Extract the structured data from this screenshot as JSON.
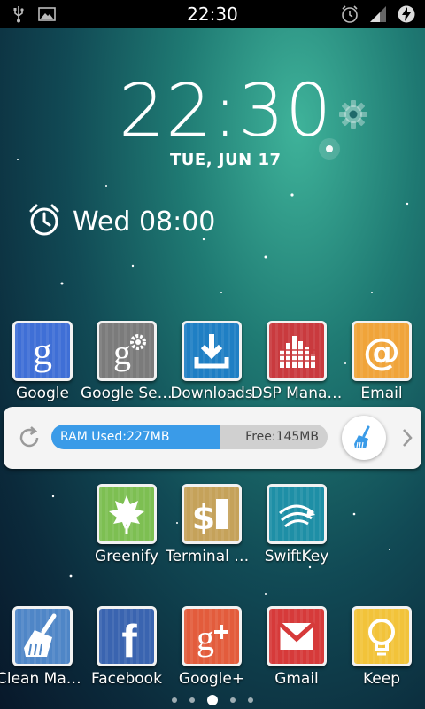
{
  "status_bar": {
    "time": "22:30",
    "left_icons": [
      "usb-icon",
      "image-icon"
    ],
    "right_icons": [
      "alarm-icon",
      "signal-icon",
      "battery-charging-icon"
    ]
  },
  "clock": {
    "time": "22:30",
    "date": "TUE, JUN 17",
    "settings_icon": "gear-icon"
  },
  "alarm": {
    "icon": "alarm-clock-icon",
    "text": "Wed 08:00"
  },
  "apps_row1": [
    {
      "label": "Google",
      "icon": "google-icon",
      "color": "#3f6fd6"
    },
    {
      "label": "Google Set…",
      "icon": "google-settings-icon",
      "color": "#7b7b7b"
    },
    {
      "label": "Downloads",
      "icon": "download-icon",
      "color": "#1f7fc4"
    },
    {
      "label": "DSP Mana…",
      "icon": "equalizer-icon",
      "color": "#c93a3e"
    },
    {
      "label": "Email",
      "icon": "at-icon",
      "color": "#f0a43a"
    }
  ],
  "ram_widget": {
    "used_label": "RAM Used:227MB",
    "free_label": "Free:145MB",
    "used_fraction": 0.61,
    "refresh_icon": "refresh-icon",
    "boost_icon": "broom-icon",
    "next_icon": "chevron-right-icon",
    "accent": "#3a9be8"
  },
  "apps_row2": [
    {
      "label": "Greenify",
      "icon": "leaf-icon",
      "color": "#7dbf52"
    },
    {
      "label": "Terminal E…",
      "icon": "terminal-icon",
      "color": "#c5a25a"
    },
    {
      "label": "SwiftKey",
      "icon": "swiftkey-icon",
      "color": "#1e8fa6"
    }
  ],
  "dock": [
    {
      "label": "Clean Mast…",
      "icon": "broom-icon",
      "color": "#4f86c7"
    },
    {
      "label": "Facebook",
      "icon": "facebook-icon",
      "color": "#3a64b0"
    },
    {
      "label": "Google+",
      "icon": "google-plus-icon",
      "color": "#e35c3c"
    },
    {
      "label": "Gmail",
      "icon": "gmail-icon",
      "color": "#d63a3a"
    },
    {
      "label": "Keep",
      "icon": "lightbulb-icon",
      "color": "#f2c33a"
    }
  ],
  "page_indicator": {
    "count": 5,
    "active": 3
  }
}
